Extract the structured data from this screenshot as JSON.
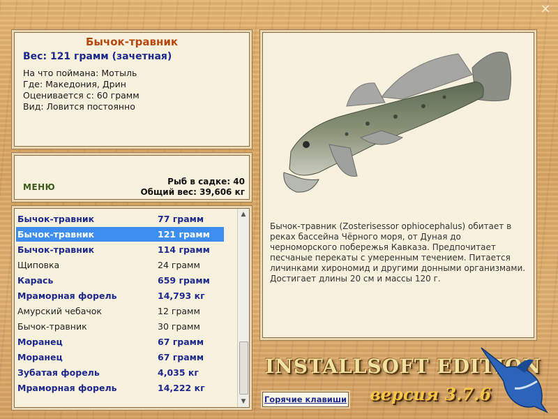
{
  "window": {
    "close_label": "✕"
  },
  "info": {
    "title": "Бычок-травник",
    "weight": "Вес: 121 грамм (зачетная)",
    "lines": [
      "На что поймана: Мотыль",
      "Где: Македония, Дрин",
      "Оценивается с: 60 грамм",
      "Вид: Ловится постоянно"
    ]
  },
  "stats": {
    "menu_label": "МЕНЮ",
    "fish_count": "Рыб в садке: 40",
    "total_weight": "Общий вес: 39,606 кг"
  },
  "catch_list": [
    {
      "name": "Бычок-травник",
      "weight": "77 грамм",
      "style": "bold"
    },
    {
      "name": "Бычок-травник",
      "weight": "121 грамм",
      "style": "selected"
    },
    {
      "name": "Бычок-травник",
      "weight": "114 грамм",
      "style": "bold"
    },
    {
      "name": "Щиповка",
      "weight": "24 грамм",
      "style": "plain"
    },
    {
      "name": "Карась",
      "weight": "659 грамм",
      "style": "bold"
    },
    {
      "name": "Мраморная форель",
      "weight": "14,793 кг",
      "style": "bold"
    },
    {
      "name": "Амурский чебачок",
      "weight": "12 грамм",
      "style": "plain"
    },
    {
      "name": "Бычок-травник",
      "weight": "30 грамм",
      "style": "plain"
    },
    {
      "name": "Моранец",
      "weight": "67 грамм",
      "style": "bold"
    },
    {
      "name": "Моранец",
      "weight": "67 грамм",
      "style": "bold"
    },
    {
      "name": "Зубатая форель",
      "weight": "4,035 кг",
      "style": "bold"
    },
    {
      "name": "Мраморная форель",
      "weight": "14,222 кг",
      "style": "bold"
    }
  ],
  "fish": {
    "description": "Бычок-травник (Zosterisessor ophiocephalus) обитает в реках бассейна Чёрного моря, от Дуная до черноморского побережья Кавказа. Предпочитает песчаные перекаты с умеренным течением. Питается личинками хирономид и другими донными организмами. Достигает длины 20 см и массы 120 г."
  },
  "branding": {
    "logo": "INSTALLSOFT EDITION",
    "version": "версия 3.7.6"
  },
  "hotkeys_label": "Горячие клавиши",
  "colors": {
    "selected_row": "#3d8ef0",
    "bold_text": "#1d2a8c",
    "title": "#b4460e"
  }
}
